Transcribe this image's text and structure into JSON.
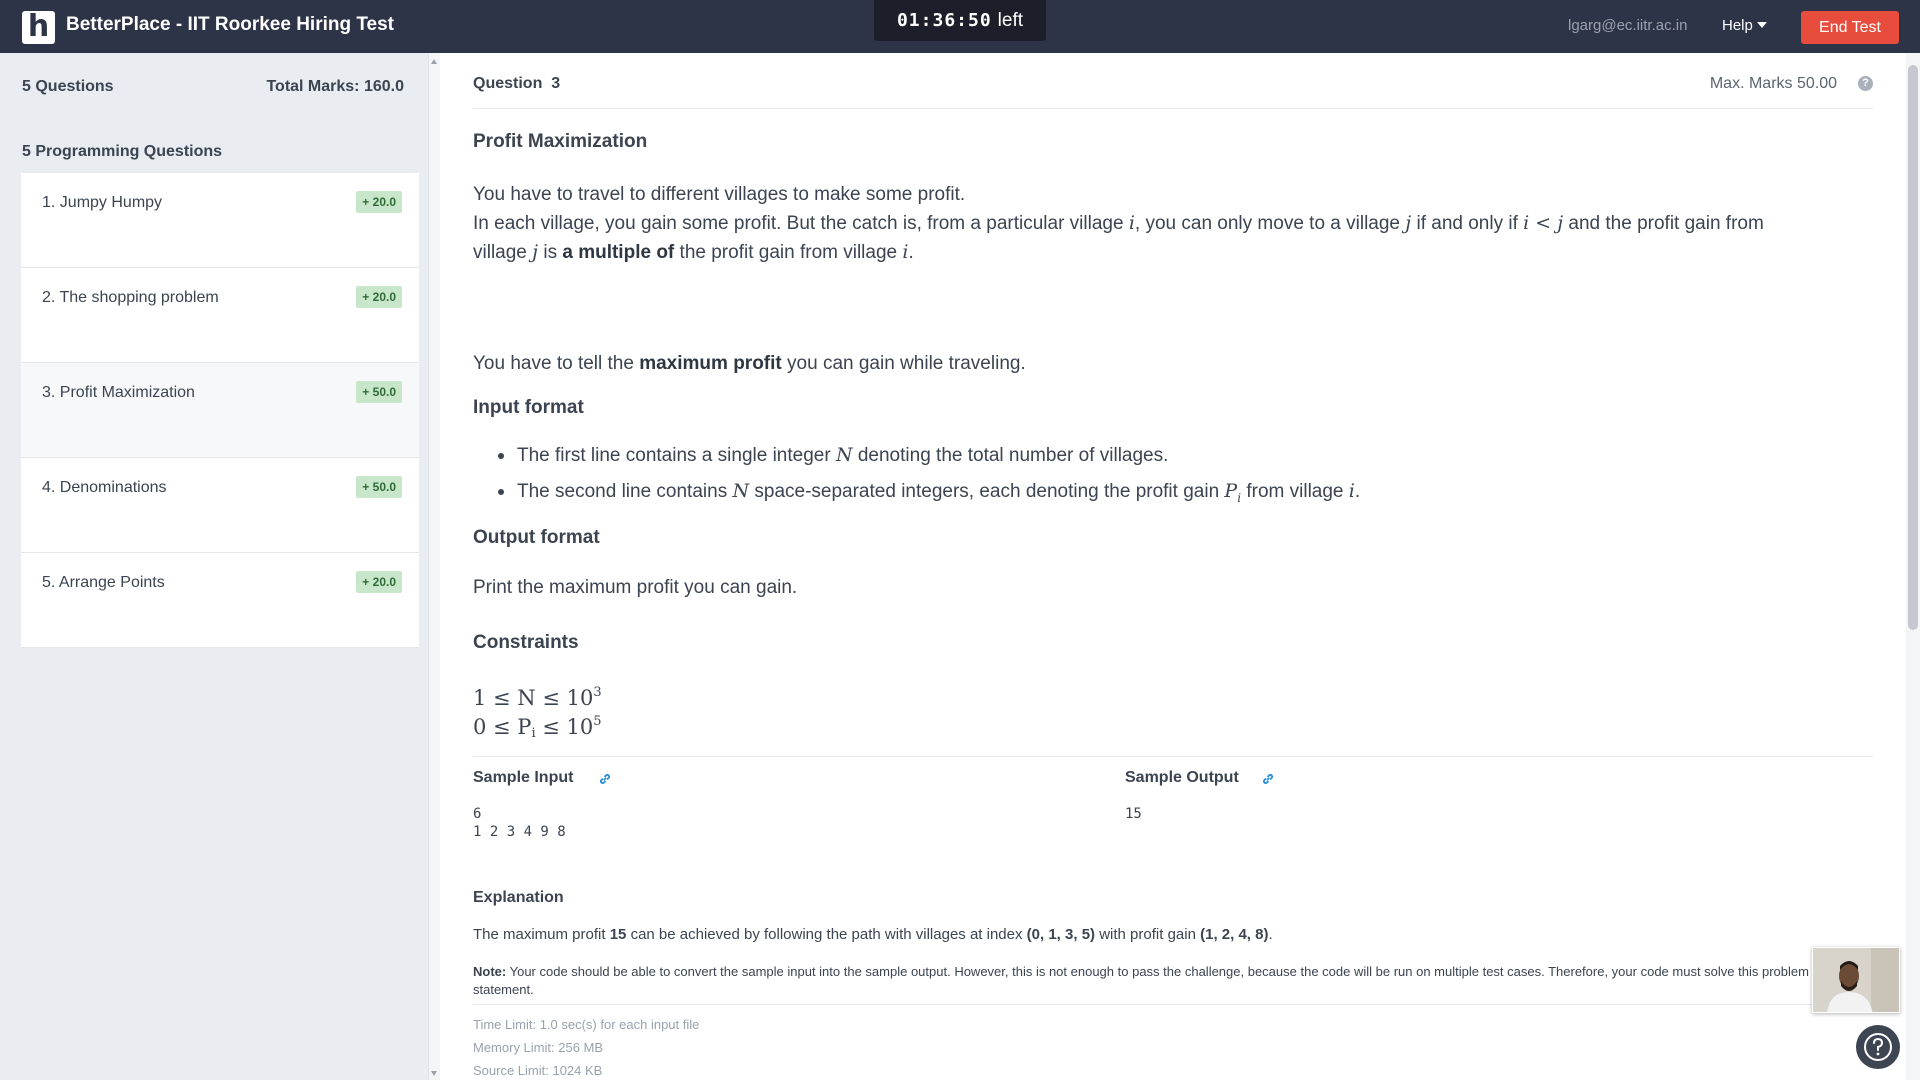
{
  "header": {
    "logo_letter": "h",
    "title": "BetterPlace - IIT Roorkee Hiring Test",
    "timer_value": "01:36:50",
    "timer_suffix": "left",
    "user_email": "lgarg@ec.iitr.ac.in",
    "help_label": "Help",
    "end_test_label": "End Test"
  },
  "sidebar": {
    "question_count": "5 Questions",
    "total_marks": "Total Marks: 160.0",
    "section_label": "5 Programming Questions",
    "active_index": 2,
    "questions": [
      {
        "label": "1. Jumpy Humpy",
        "marks": "+ 20.0"
      },
      {
        "label": "2. The shopping problem",
        "marks": "+ 20.0"
      },
      {
        "label": "3. Profit Maximization",
        "marks": "+ 50.0"
      },
      {
        "label": "4. Denominations",
        "marks": "+ 50.0"
      },
      {
        "label": "5. Arrange Points",
        "marks": "+ 20.0"
      }
    ]
  },
  "question": {
    "label": "Question",
    "number": "3",
    "max_marks": "Max. Marks 50.00",
    "title": "Profit Maximization",
    "intro_1": "You have to travel to different villages to make some profit.",
    "intro_2a": "In each village, you gain some profit. But the catch is, from a particular village",
    "var_i": "i",
    "intro_2b": ", you can only move to a village",
    "var_j": "j",
    "intro_2c": "if and only if",
    "cond_lt": "i < j",
    "intro_2d": "and the profit gain from",
    "intro_3a": "village",
    "intro_3b": "is",
    "multiple_of": "a multiple of",
    "intro_3c": "the profit gain from village",
    "intro_3d": ".",
    "task_a": "You have to tell the",
    "task_bold": "maximum profit",
    "task_b": "you can gain while traveling.",
    "input_heading": "Input format",
    "input_1a": "The first line contains a single integer",
    "var_n": "N",
    "input_1b": "denoting the total number of villages.",
    "input_2a": "The second line contains",
    "input_2b": "space-separated integers, each denoting the profit gain",
    "var_p": "P",
    "sub_i": "i",
    "input_2c": "from village",
    "output_heading": "Output format",
    "output_text": "Print the maximum profit you can gain.",
    "constraints_heading": "Constraints",
    "constraint_1a": "1 ≤ N ≤ 10",
    "constraint_1_exp": "3",
    "constraint_2a": "0 ≤ P",
    "constraint_2b": " ≤ 10",
    "constraint_2_exp": "5",
    "sample_input_label": "Sample Input",
    "sample_input_value": "6\n1 2 3 4 9 8",
    "sample_output_label": "Sample Output",
    "sample_output_value": "15",
    "explanation_heading": "Explanation",
    "expl_a": "The maximum profit",
    "expl_val": "15",
    "expl_b": "can be achieved by following the path with villages at index",
    "expl_path": "(0, 1, 3, 5)",
    "expl_c": "with profit gain",
    "expl_gain": "(1, 2, 4, 8)",
    "expl_d": ".",
    "note_label": "Note:",
    "note_text": "Your code should be able to convert the sample input into the sample output. However, this is not enough to pass the challenge, because the code will be run on multiple test cases. Therefore, your code must solve this problem statement.",
    "time_limit": "Time Limit: 1.0 sec(s) for each input file",
    "memory_limit": "Memory Limit: 256 MB",
    "source_limit": "Source Limit: 1024 KB"
  },
  "colors": {
    "header_bg": "#2e3447",
    "end_test": "#e74c3c",
    "sidebar_bg": "#e9edf2",
    "marks_badge": "#c8e6c9",
    "link_blue": "#2b8fd6"
  }
}
